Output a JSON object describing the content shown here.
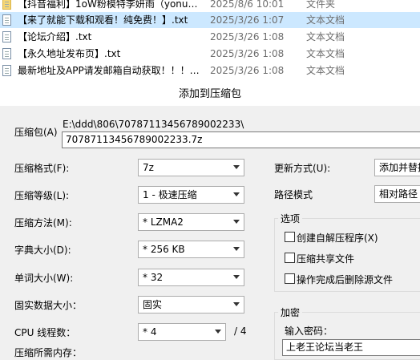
{
  "file_list": [
    {
      "name": "【抖音福利】1oW粉模特李妍雨（yonu…",
      "date": "2025/8/6 10:01",
      "type": "文件夹",
      "selected": false
    },
    {
      "name": "【来了就能下载和观看！纯免费！】.txt",
      "date": "2025/3/26 1:07",
      "type": "文本文档",
      "selected": true
    },
    {
      "name": "【论坛介绍】.txt",
      "date": "2025/3/26 1:08",
      "type": "文本文档",
      "selected": false
    },
    {
      "name": "【永久地址发布页】.txt",
      "date": "2025/3/26 1:08",
      "type": "文本文档",
      "selected": false
    },
    {
      "name": "最新地址及APP请发邮箱自动获取！！！…",
      "date": "2025/3/26 1:08",
      "type": "文本文档",
      "selected": false
    }
  ],
  "dialog": {
    "title": "添加到压缩包",
    "archive_label": "压缩包(A)",
    "archive_path": "E:\\ddd\\806\\70787113456789002233\\",
    "archive_name": "70787113456789002233.7z",
    "format_label": "压缩格式(F):",
    "format_value": "7z",
    "level_label": "压缩等级(L):",
    "level_value": "1 - 极速压缩",
    "method_label": "压缩方法(M):",
    "method_value": "* LZMA2",
    "dict_label": "字典大小(D):",
    "dict_value": "* 256 KB",
    "word_label": "单词大小(W):",
    "word_value": "* 32",
    "solid_label": "固实数据大小：",
    "solid_value": "固实",
    "cpu_label": "CPU 线程数：",
    "cpu_value": "* 4",
    "cpu_total": "/ 4",
    "memory_label": "压缩所需内存：",
    "update_label": "更新方式(U):",
    "update_value": "添加并替换",
    "path_label": "路径模式",
    "path_value": "相对路径",
    "options_title": "选项",
    "opt_sfx": "创建自解压程序(X)",
    "opt_shared": "压缩共享文件",
    "opt_delete": "操作完成后删除源文件",
    "encrypt_title": "加密",
    "password_label": "输入密码：",
    "password_value": "上老王论坛当老王"
  }
}
